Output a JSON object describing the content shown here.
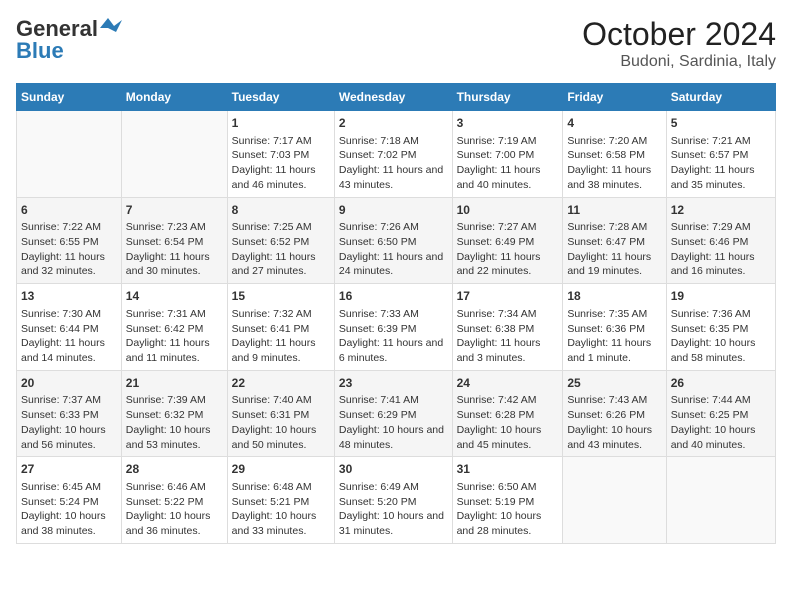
{
  "header": {
    "logo_line1": "General",
    "logo_line2": "Blue",
    "title": "October 2024",
    "subtitle": "Budoni, Sardinia, Italy"
  },
  "days_of_week": [
    "Sunday",
    "Monday",
    "Tuesday",
    "Wednesday",
    "Thursday",
    "Friday",
    "Saturday"
  ],
  "weeks": [
    [
      {
        "day": "",
        "info": ""
      },
      {
        "day": "",
        "info": ""
      },
      {
        "day": "1",
        "info": "Sunrise: 7:17 AM\nSunset: 7:03 PM\nDaylight: 11 hours and 46 minutes."
      },
      {
        "day": "2",
        "info": "Sunrise: 7:18 AM\nSunset: 7:02 PM\nDaylight: 11 hours and 43 minutes."
      },
      {
        "day": "3",
        "info": "Sunrise: 7:19 AM\nSunset: 7:00 PM\nDaylight: 11 hours and 40 minutes."
      },
      {
        "day": "4",
        "info": "Sunrise: 7:20 AM\nSunset: 6:58 PM\nDaylight: 11 hours and 38 minutes."
      },
      {
        "day": "5",
        "info": "Sunrise: 7:21 AM\nSunset: 6:57 PM\nDaylight: 11 hours and 35 minutes."
      }
    ],
    [
      {
        "day": "6",
        "info": "Sunrise: 7:22 AM\nSunset: 6:55 PM\nDaylight: 11 hours and 32 minutes."
      },
      {
        "day": "7",
        "info": "Sunrise: 7:23 AM\nSunset: 6:54 PM\nDaylight: 11 hours and 30 minutes."
      },
      {
        "day": "8",
        "info": "Sunrise: 7:25 AM\nSunset: 6:52 PM\nDaylight: 11 hours and 27 minutes."
      },
      {
        "day": "9",
        "info": "Sunrise: 7:26 AM\nSunset: 6:50 PM\nDaylight: 11 hours and 24 minutes."
      },
      {
        "day": "10",
        "info": "Sunrise: 7:27 AM\nSunset: 6:49 PM\nDaylight: 11 hours and 22 minutes."
      },
      {
        "day": "11",
        "info": "Sunrise: 7:28 AM\nSunset: 6:47 PM\nDaylight: 11 hours and 19 minutes."
      },
      {
        "day": "12",
        "info": "Sunrise: 7:29 AM\nSunset: 6:46 PM\nDaylight: 11 hours and 16 minutes."
      }
    ],
    [
      {
        "day": "13",
        "info": "Sunrise: 7:30 AM\nSunset: 6:44 PM\nDaylight: 11 hours and 14 minutes."
      },
      {
        "day": "14",
        "info": "Sunrise: 7:31 AM\nSunset: 6:42 PM\nDaylight: 11 hours and 11 minutes."
      },
      {
        "day": "15",
        "info": "Sunrise: 7:32 AM\nSunset: 6:41 PM\nDaylight: 11 hours and 9 minutes."
      },
      {
        "day": "16",
        "info": "Sunrise: 7:33 AM\nSunset: 6:39 PM\nDaylight: 11 hours and 6 minutes."
      },
      {
        "day": "17",
        "info": "Sunrise: 7:34 AM\nSunset: 6:38 PM\nDaylight: 11 hours and 3 minutes."
      },
      {
        "day": "18",
        "info": "Sunrise: 7:35 AM\nSunset: 6:36 PM\nDaylight: 11 hours and 1 minute."
      },
      {
        "day": "19",
        "info": "Sunrise: 7:36 AM\nSunset: 6:35 PM\nDaylight: 10 hours and 58 minutes."
      }
    ],
    [
      {
        "day": "20",
        "info": "Sunrise: 7:37 AM\nSunset: 6:33 PM\nDaylight: 10 hours and 56 minutes."
      },
      {
        "day": "21",
        "info": "Sunrise: 7:39 AM\nSunset: 6:32 PM\nDaylight: 10 hours and 53 minutes."
      },
      {
        "day": "22",
        "info": "Sunrise: 7:40 AM\nSunset: 6:31 PM\nDaylight: 10 hours and 50 minutes."
      },
      {
        "day": "23",
        "info": "Sunrise: 7:41 AM\nSunset: 6:29 PM\nDaylight: 10 hours and 48 minutes."
      },
      {
        "day": "24",
        "info": "Sunrise: 7:42 AM\nSunset: 6:28 PM\nDaylight: 10 hours and 45 minutes."
      },
      {
        "day": "25",
        "info": "Sunrise: 7:43 AM\nSunset: 6:26 PM\nDaylight: 10 hours and 43 minutes."
      },
      {
        "day": "26",
        "info": "Sunrise: 7:44 AM\nSunset: 6:25 PM\nDaylight: 10 hours and 40 minutes."
      }
    ],
    [
      {
        "day": "27",
        "info": "Sunrise: 6:45 AM\nSunset: 5:24 PM\nDaylight: 10 hours and 38 minutes."
      },
      {
        "day": "28",
        "info": "Sunrise: 6:46 AM\nSunset: 5:22 PM\nDaylight: 10 hours and 36 minutes."
      },
      {
        "day": "29",
        "info": "Sunrise: 6:48 AM\nSunset: 5:21 PM\nDaylight: 10 hours and 33 minutes."
      },
      {
        "day": "30",
        "info": "Sunrise: 6:49 AM\nSunset: 5:20 PM\nDaylight: 10 hours and 31 minutes."
      },
      {
        "day": "31",
        "info": "Sunrise: 6:50 AM\nSunset: 5:19 PM\nDaylight: 10 hours and 28 minutes."
      },
      {
        "day": "",
        "info": ""
      },
      {
        "day": "",
        "info": ""
      }
    ]
  ]
}
